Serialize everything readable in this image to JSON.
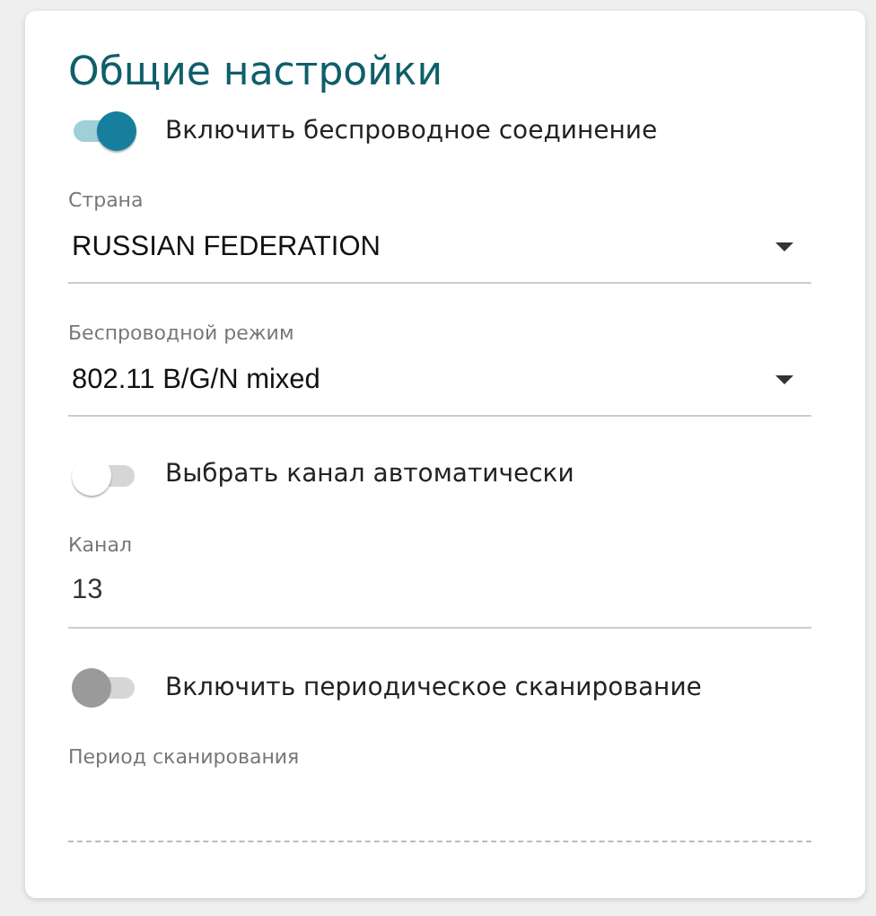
{
  "title": "Общие настройки",
  "items": [
    {
      "kind": "toggle",
      "label": "Включить беспроводное соединение",
      "on": true,
      "disabled": false
    },
    {
      "kind": "select",
      "label": "Страна",
      "value": "RUSSIAN FEDERATION"
    },
    {
      "kind": "select",
      "label": "Беспроводной режим",
      "value": "802.11 B/G/N mixed"
    },
    {
      "kind": "toggle",
      "label": "Выбрать канал автоматически",
      "on": false,
      "disabled": false
    },
    {
      "kind": "input",
      "label": "Канал",
      "value": "13",
      "disabled": false
    },
    {
      "kind": "toggle",
      "label": "Включить периодическое сканирование",
      "on": false,
      "disabled": true
    },
    {
      "kind": "input",
      "label": "Период сканирования",
      "disabled": true
    }
  ]
}
